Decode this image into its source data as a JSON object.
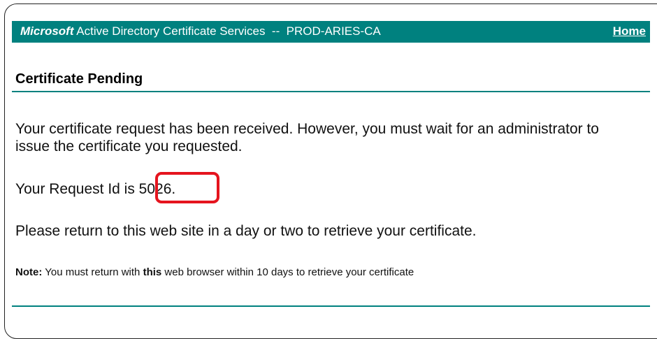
{
  "header": {
    "brand": "Microsoft",
    "title_rest": " Active Directory Certificate Services  --  PROD-ARIES-CA",
    "home_label": "Home"
  },
  "page": {
    "title": "Certificate Pending",
    "message_line": "Your certificate request has been received. However, you must wait for an administrator to issue the certificate you requested.",
    "request_id_prefix": "Your Request Id is ",
    "request_id": "5026",
    "request_id_suffix": ".",
    "return_text": "Please return to this web site in a day or two to retrieve your certificate.",
    "note_label": "Note:",
    "note_text_1": " You must return with ",
    "note_bold": "this",
    "note_text_2": " web browser within 10 days to retrieve your certificate"
  },
  "colors": {
    "accent": "#00817f",
    "highlight": "#e5141e"
  }
}
